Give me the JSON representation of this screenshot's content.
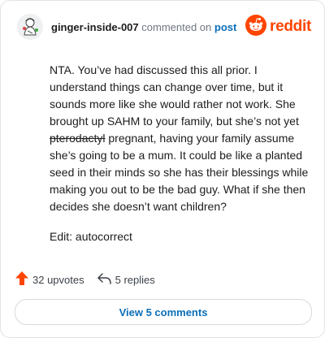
{
  "header": {
    "username": "ginger-inside-007",
    "action": "commented on",
    "post_label": "post",
    "brand": "reddit"
  },
  "comment": {
    "part1": "NTA. You’ve had discussed this all prior. I understand things can change over time, but it sounds more like she would rather not work. She brought up SAHM to your family, but she’s not yet ",
    "struck": "pterodactyl",
    "part2": " pregnant, having your family assume she’s going to be a mum. It could be like a planted seed in their minds so she has their blessings while making you out to be the bad guy. What if she then decides she doesn’t want children?",
    "edit": "Edit: autocorrect"
  },
  "stats": {
    "upvotes": "32 upvotes",
    "replies": "5 replies"
  },
  "view_button": "View 5 comments",
  "colors": {
    "brand": "#ff4500",
    "link": "#0b6fb8",
    "muted": "#6f7780"
  },
  "icons": [
    "avatar",
    "reddit-logo-icon",
    "upvote-arrow-icon",
    "reply-arrow-icon"
  ]
}
